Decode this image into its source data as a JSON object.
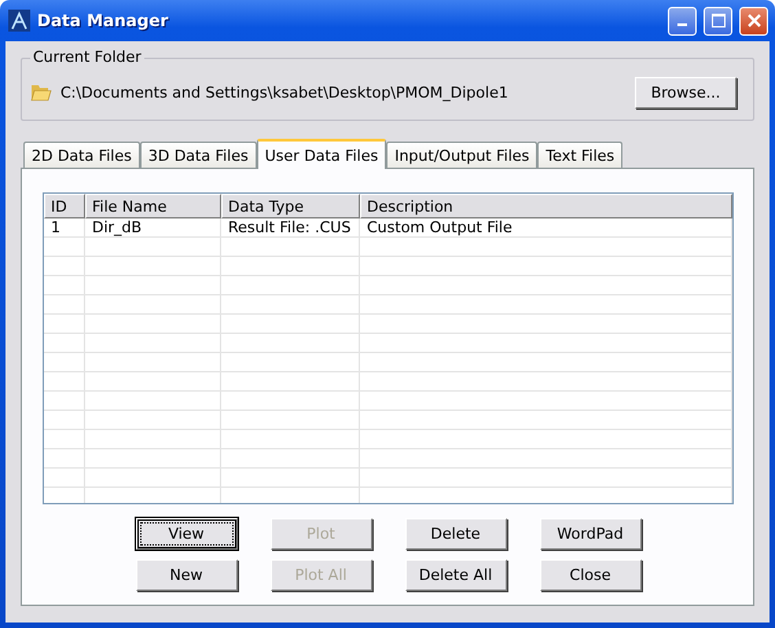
{
  "window": {
    "title": "Data Manager"
  },
  "current_folder": {
    "label": "Current Folder",
    "path": "C:\\Documents and Settings\\ksabet\\Desktop\\PMOM_Dipole1",
    "browse_button": "Browse..."
  },
  "tabs": [
    {
      "label": "2D Data Files",
      "selected": false
    },
    {
      "label": "3D Data Files",
      "selected": false
    },
    {
      "label": "User Data Files",
      "selected": true
    },
    {
      "label": "Input/Output Files",
      "selected": false
    },
    {
      "label": "Text Files",
      "selected": false
    }
  ],
  "table": {
    "columns": [
      "ID",
      "File Name",
      "Data Type",
      "Description"
    ],
    "rows": [
      [
        "1",
        "Dir_dB",
        "Result File: .CUS",
        "Custom Output File"
      ]
    ]
  },
  "buttons": [
    {
      "label": "View",
      "disabled": false,
      "focused": true
    },
    {
      "label": "Plot",
      "disabled": true,
      "focused": false
    },
    {
      "label": "Delete",
      "disabled": false,
      "focused": false
    },
    {
      "label": "WordPad",
      "disabled": false,
      "focused": false
    },
    {
      "label": "New",
      "disabled": false,
      "focused": false
    },
    {
      "label": "Plot All",
      "disabled": true,
      "focused": false
    },
    {
      "label": "Delete All",
      "disabled": false,
      "focused": false
    },
    {
      "label": "Close",
      "disabled": false,
      "focused": false
    }
  ]
}
